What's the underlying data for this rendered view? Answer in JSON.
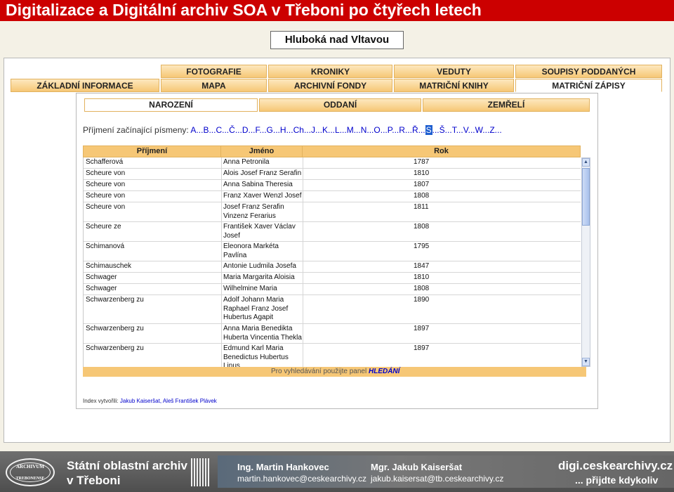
{
  "slide": {
    "title": "Digitalizace a Digitální archiv SOA v Třeboni po čtyřech letech"
  },
  "place": "Hluboká nad Vltavou",
  "main_tabs": {
    "row1": [
      "FOTOGRAFIE",
      "KRONIKY",
      "VEDUTY",
      "SOUPISY PODDANÝCH"
    ],
    "row2": [
      "ZÁKLADNÍ INFORMACE",
      "MAPA",
      "ARCHIVNÍ FONDY",
      "MATRIČNÍ KNIHY",
      "MATRIČNÍ ZÁPISY"
    ],
    "active": "MATRIČNÍ ZÁPISY"
  },
  "sub_tabs": [
    "NAROZENÍ",
    "ODDANÍ",
    "ZEMŘELÍ"
  ],
  "letters": {
    "label": "Příjmení začínající písmeny:",
    "items": [
      "A",
      "B",
      "C",
      "Č",
      "D",
      "F",
      "G",
      "H",
      "Ch",
      "J",
      "K",
      "L",
      "M",
      "N",
      "O",
      "P",
      "R",
      "Ř",
      "S",
      "Š",
      "T",
      "V",
      "W",
      "Z"
    ],
    "selected": "S"
  },
  "table": {
    "columns": [
      "Příjmení",
      "Jméno",
      "Rok"
    ],
    "rows": [
      {
        "surname": "Schafferová",
        "names": [
          "Anna Petronila"
        ],
        "year": "1787"
      },
      {
        "surname": "Scheure von",
        "names": [
          "Alois Josef Franz Serafin"
        ],
        "year": "1810"
      },
      {
        "surname": "Scheure von",
        "names": [
          "Anna Sabina Theresia"
        ],
        "year": "1807"
      },
      {
        "surname": "Scheure von",
        "names": [
          "Franz Xaver Wenzl Josef"
        ],
        "year": "1808"
      },
      {
        "surname": "Scheure von",
        "names": [
          "Josef Franz Serafin",
          "Vinzenz Ferarius"
        ],
        "year": "1811"
      },
      {
        "surname": "Scheure ze",
        "names": [
          "František Xaver Václav",
          "Josef"
        ],
        "year": "1808"
      },
      {
        "surname": "Schimanová",
        "names": [
          "Eleonora Markéta",
          "Pavlína"
        ],
        "year": "1795"
      },
      {
        "surname": "Schimauschek",
        "names": [
          "Antonie Ludmila Josefa"
        ],
        "year": "1847"
      },
      {
        "surname": "Schwager",
        "names": [
          "Maria Margarita Aloisia"
        ],
        "year": "1810"
      },
      {
        "surname": "Schwager",
        "names": [
          "Wilhelmine Maria"
        ],
        "year": "1808"
      },
      {
        "surname": "Schwarzenberg zu",
        "names": [
          "Adolf Johann Maria",
          "Raphael Franz Josef",
          "Hubertus Agapit"
        ],
        "year": "1890"
      },
      {
        "surname": "Schwarzenberg zu",
        "names": [
          "Anna Maria Benedikta",
          "Huberta Vincentia Thekla"
        ],
        "year": "1897"
      },
      {
        "surname": "Schwarzenberg zu",
        "names": [
          "Edmund Karl Maria",
          "Benedictus Hubertus",
          "Linus"
        ],
        "year": "1897"
      }
    ]
  },
  "footer": {
    "text": "Pro vyhledávání použijte panel",
    "link": "HLEDÁNÍ"
  },
  "credits": {
    "label": "Index vytvořili:",
    "names": "Jakub Kaiseršat, Aleš František Plávek"
  },
  "bottom": {
    "seal_top": "ARCHIVUM",
    "seal_bottom": "TREBONENSE",
    "org_line1": "Státní oblastní archiv",
    "org_line2": "v Třeboni",
    "person1_name": "Ing. Martin Hankovec",
    "person1_email": "martin.hankovec@ceskearchivy.cz",
    "person2_name": "Mgr. Jakub Kaiseršat",
    "person2_email": "jakub.kaisersat@tb.ceskearchivy.cz",
    "site": "digi.ceskearchivy.cz",
    "tagline": "... přijdte kdykoliv"
  }
}
